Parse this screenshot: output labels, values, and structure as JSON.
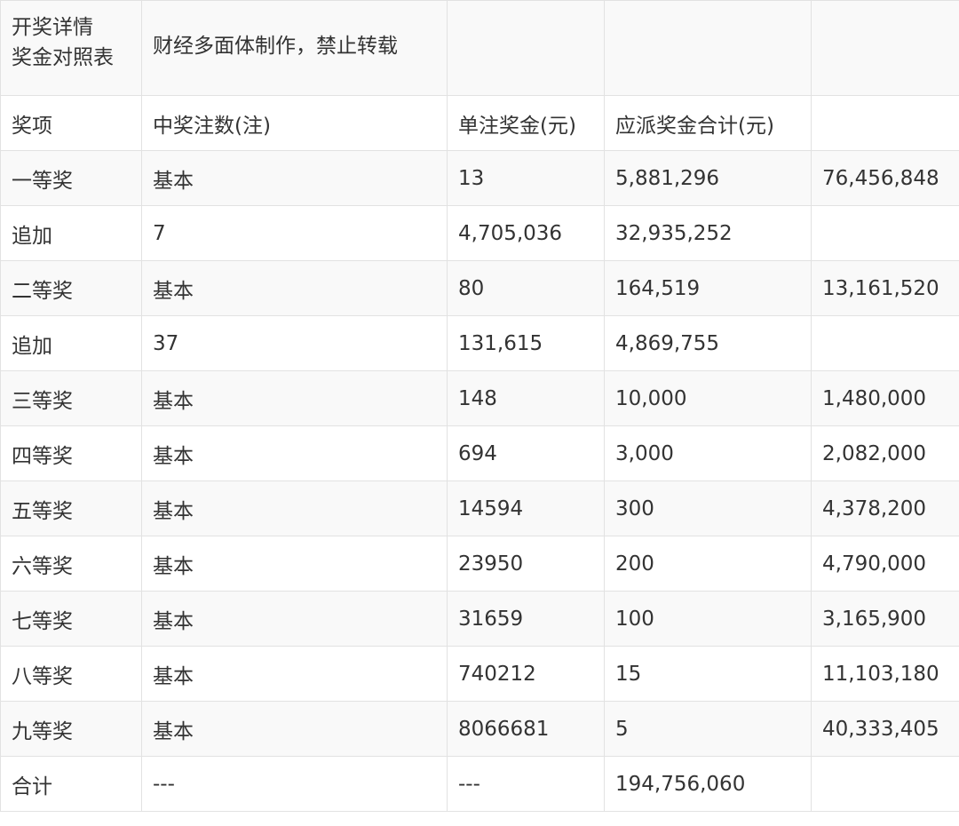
{
  "table_title_lines": [
    "开奖详情",
    "奖金对照表"
  ],
  "source_note": "财经多面体制作，禁止转载",
  "column_headers": [
    "奖项",
    "中奖注数(注)",
    "单注奖金(元)",
    "应派奖金合计(元)",
    ""
  ],
  "rows": [
    [
      "一等奖",
      "基本",
      "13",
      "5,881,296",
      "76,456,848"
    ],
    [
      "追加",
      "7",
      "4,705,036",
      "32,935,252",
      ""
    ],
    [
      "二等奖",
      "基本",
      "80",
      "164,519",
      "13,161,520"
    ],
    [
      "追加",
      "37",
      "131,615",
      "4,869,755",
      ""
    ],
    [
      "三等奖",
      "基本",
      "148",
      "10,000",
      "1,480,000"
    ],
    [
      "四等奖",
      "基本",
      "694",
      "3,000",
      "2,082,000"
    ],
    [
      "五等奖",
      "基本",
      "14594",
      "300",
      "4,378,200"
    ],
    [
      "六等奖",
      "基本",
      "23950",
      "200",
      "4,790,000"
    ],
    [
      "七等奖",
      "基本",
      "31659",
      "100",
      "3,165,900"
    ],
    [
      "八等奖",
      "基本",
      "740212",
      "15",
      "11,103,180"
    ],
    [
      "九等奖",
      "基本",
      "8066681",
      "5",
      "40,333,405"
    ],
    [
      "合计",
      "---",
      "---",
      "194,756,060",
      ""
    ]
  ],
  "colors": {
    "text": "#333333",
    "border": "#e2e2e2",
    "band_shaded": "#f9f9f9",
    "band_plain": "#ffffff"
  }
}
